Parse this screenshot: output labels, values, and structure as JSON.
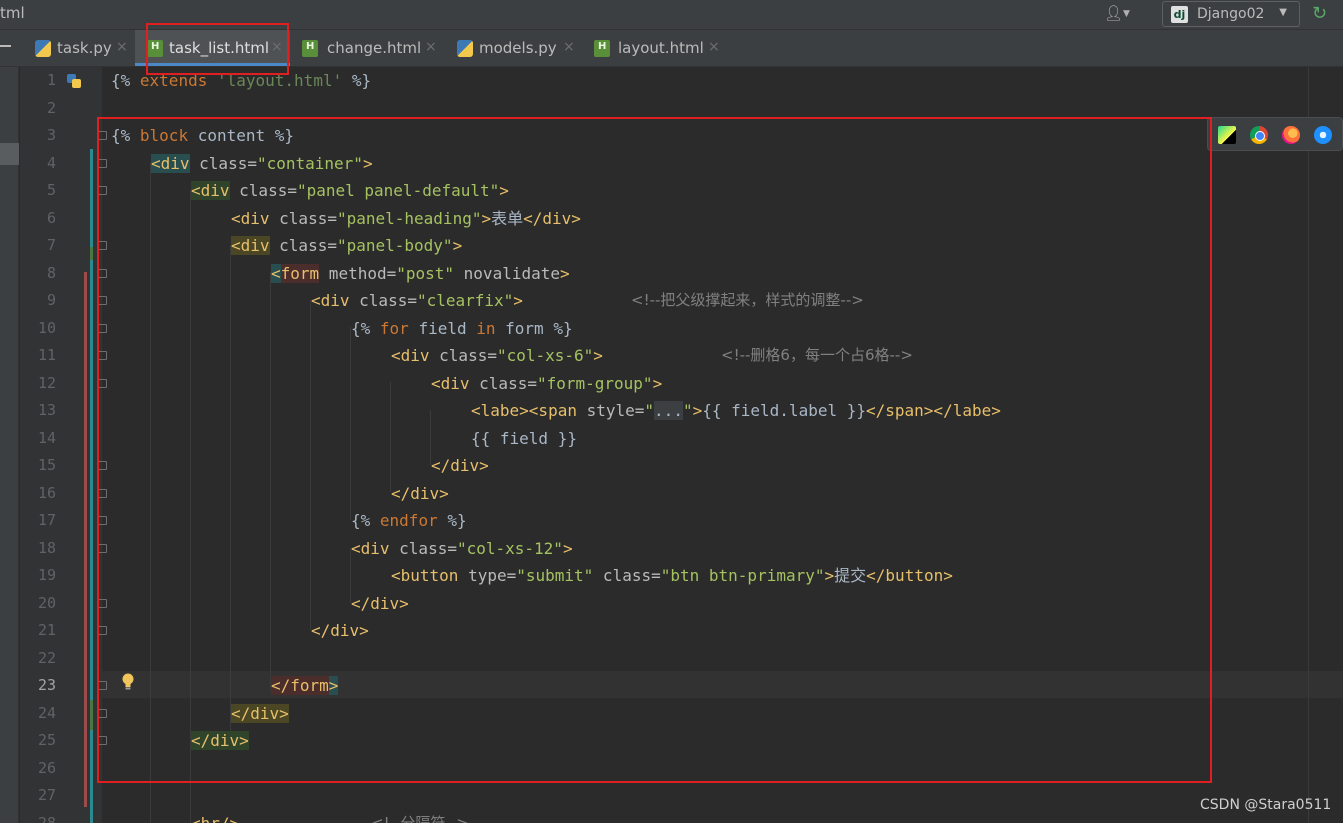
{
  "window": {
    "title_fragment": "tml"
  },
  "toolbar": {
    "run_config": "Django02",
    "run_config_icon": "dj"
  },
  "tabs": [
    {
      "label": "task.py",
      "close": "×"
    },
    {
      "label": "task_list.html",
      "close": "×"
    },
    {
      "label": "change.html",
      "close": "×"
    },
    {
      "label": "models.py",
      "close": "×"
    },
    {
      "label": "layout.html",
      "close": "×"
    }
  ],
  "editor": {
    "current_line": 23,
    "line_numbers": [
      "1",
      "2",
      "3",
      "4",
      "5",
      "6",
      "7",
      "8",
      "9",
      "10",
      "11",
      "12",
      "13",
      "14",
      "15",
      "16",
      "17",
      "18",
      "19",
      "20",
      "21",
      "22",
      "23",
      "24",
      "25",
      "26",
      "27",
      "28"
    ],
    "code": {
      "l1_a": "{% ",
      "l1_b": "extends",
      "l1_c": " ",
      "l1_d": "'layout.html'",
      "l1_e": " %}",
      "l3_a": "{% ",
      "l3_b": "block",
      "l3_c": " content %}",
      "l4_a": "<div",
      "l4_b": " class=",
      "l4_c": "\"container\"",
      "l4_d": ">",
      "l5_a": "<div",
      "l5_b": " class=",
      "l5_c": "\"panel panel-default\"",
      "l5_d": ">",
      "l6_a": "<div",
      "l6_b": " class=",
      "l6_c": "\"panel-heading\"",
      "l6_d": ">",
      "l6_e": "表单",
      "l6_f": "</div>",
      "l7_a": "<div",
      "l7_b": " class=",
      "l7_c": "\"panel-body\"",
      "l7_d": ">",
      "l8_a": "<",
      "l8_b": "form",
      "l8_c": " method=",
      "l8_d": "\"post\"",
      "l8_e": " novalidate",
      "l8_f": ">",
      "l9_a": "<div",
      "l9_b": " class=",
      "l9_c": "\"clearfix\"",
      "l9_d": ">",
      "l9_e": "<!--把父级撑起来，样式的调整-->",
      "l10_a": "{% ",
      "l10_b": "for",
      "l10_c": " field ",
      "l10_d": "in",
      "l10_e": " form %}",
      "l11_a": "<div",
      "l11_b": " class=",
      "l11_c": "\"col-xs-6\"",
      "l11_d": ">",
      "l11_e": "<!--删格6，每一个占6格-->",
      "l12_a": "<div",
      "l12_b": " class=",
      "l12_c": "\"form-group\"",
      "l12_d": ">",
      "l13_a": "<labe><span",
      "l13_b": " style=",
      "l13_c": "\"",
      "l13_d": "...",
      "l13_e": "\"",
      "l13_f": ">",
      "l13_g": "{{ field.label }}",
      "l13_h": "</span></labe>",
      "l14_a": "{{ field }}",
      "l15_a": "</div>",
      "l16_a": "</div>",
      "l17_a": "{% ",
      "l17_b": "endfor",
      "l17_c": " %}",
      "l18_a": "<div",
      "l18_b": " class=",
      "l18_c": "\"col-xs-12\"",
      "l18_d": ">",
      "l19_a": "<button",
      "l19_b": " type=",
      "l19_c": "\"submit\"",
      "l19_d": " class=",
      "l19_e": "\"btn btn-primary\"",
      "l19_f": ">",
      "l19_g": "提交",
      "l19_h": "</button>",
      "l20_a": "</div>",
      "l21_a": "</div>",
      "l23_a": "</",
      "l23_b": "form",
      "l23_c": ">",
      "l24_a": "</div>",
      "l25_a": "</div>",
      "l28_a": "<hr/>",
      "l28_b": "<!--分隔符-->"
    }
  },
  "watermark": "CSDN @Stara0511",
  "colors": {
    "annotation_red": "#e02020",
    "active_tab_underline": "#4a88c7",
    "editor_bg": "#2b2b2b"
  }
}
